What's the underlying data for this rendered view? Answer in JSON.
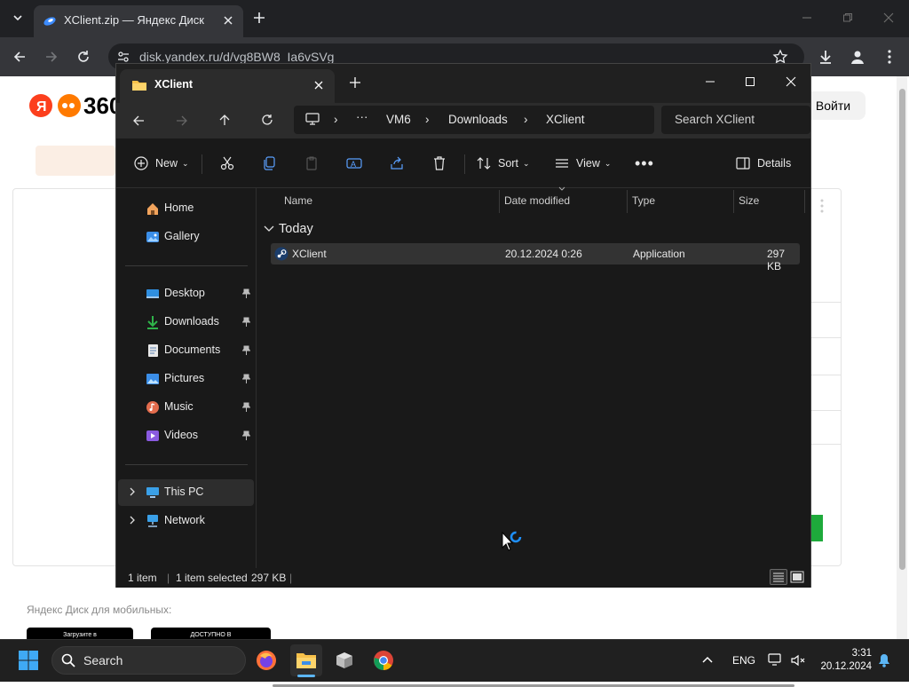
{
  "browser": {
    "tab_title": "XClient.zip — Яндекс Диск",
    "url": "disk.yandex.ru/d/vg8BW8_Ia6vSVg",
    "icons": [
      "tab-list-icon",
      "yandex-disk-favicon",
      "close-tab-icon",
      "new-tab-icon",
      "back-icon",
      "forward-icon",
      "reload-icon",
      "site-info-icon",
      "bookmark-star-icon",
      "download-icon",
      "profile-icon",
      "menu-icon"
    ]
  },
  "web_page": {
    "logo_text": "360",
    "login_label": "Войти",
    "mobile_text": "Яндекс Диск для мобильных:",
    "badge1": "Загрузите в",
    "badge2": "ДОСТУПНО В"
  },
  "explorer": {
    "tab_title": "XClient",
    "breadcrumb": [
      "VM6",
      "Downloads",
      "XClient"
    ],
    "search_placeholder": "Search XClient",
    "commands": {
      "new": "New",
      "sort": "Sort",
      "view": "View",
      "details": "Details"
    },
    "nav": {
      "home": "Home",
      "gallery": "Gallery",
      "quick_access": [
        "Desktop",
        "Downloads",
        "Documents",
        "Pictures",
        "Music",
        "Videos"
      ],
      "this_pc": "This PC",
      "network": "Network"
    },
    "columns": [
      "Name",
      "Date modified",
      "Type",
      "Size"
    ],
    "group": "Today",
    "file": {
      "name": "XClient",
      "date": "20.12.2024 0:26",
      "type": "Application",
      "size": "297 KB"
    },
    "status": {
      "count": "1 item",
      "selected": "1 item selected",
      "size": "297 KB"
    }
  },
  "taskbar": {
    "search_label": "Search",
    "lang": "ENG",
    "time": "3:31",
    "date": "20.12.2024"
  },
  "colors": {
    "explorer_bg": "#191919",
    "selection": "#333333",
    "accent_folder": "#f8c14a",
    "chrome_dark": "#202124"
  }
}
